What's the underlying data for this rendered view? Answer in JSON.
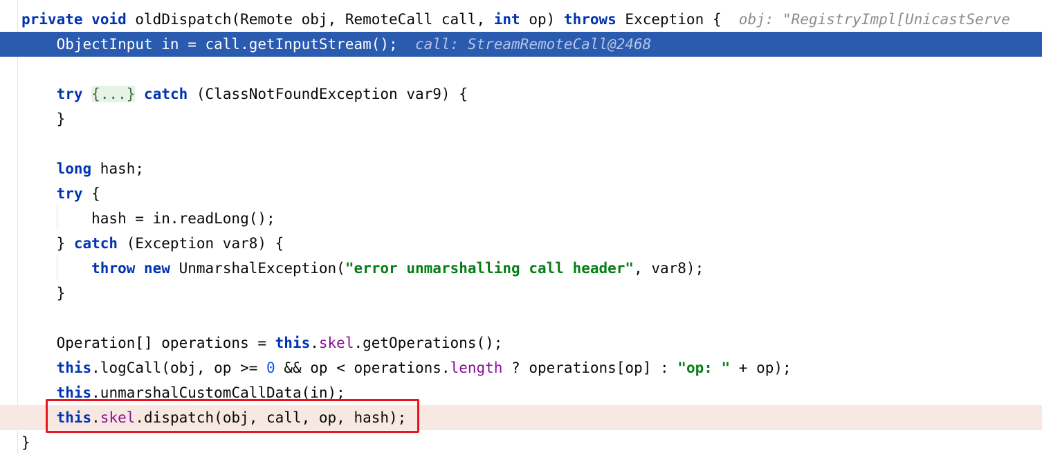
{
  "editor": {
    "language": "java",
    "lines": [
      {
        "id": "l1",
        "tokens": [
          [
            "kw",
            "private"
          ],
          [
            "t",
            " "
          ],
          [
            "kw",
            "void"
          ],
          [
            "t",
            " oldDispatch(Remote obj, RemoteCall call, "
          ],
          [
            "kw",
            "int"
          ],
          [
            "t",
            " op) "
          ],
          [
            "kw",
            "throws"
          ],
          [
            "t",
            " Exception {  "
          ],
          [
            "hint",
            "obj: \"RegistryImpl[UnicastServe"
          ]
        ]
      },
      {
        "id": "l2",
        "selected": true,
        "tokens": [
          [
            "t",
            "    ObjectInput in = call.getInputStream();  "
          ],
          [
            "hint",
            "call: StreamRemoteCall@2468"
          ]
        ]
      },
      {
        "id": "l3",
        "tokens": []
      },
      {
        "id": "l4",
        "tokens": [
          [
            "t",
            "    "
          ],
          [
            "kw",
            "try"
          ],
          [
            "t",
            " "
          ],
          [
            "fold",
            "{...}"
          ],
          [
            "t",
            " "
          ],
          [
            "kw",
            "catch"
          ],
          [
            "t",
            " (ClassNotFoundException var9) {"
          ]
        ]
      },
      {
        "id": "l5",
        "tokens": [
          [
            "t",
            "    }"
          ]
        ]
      },
      {
        "id": "l6",
        "tokens": []
      },
      {
        "id": "l7",
        "tokens": [
          [
            "t",
            "    "
          ],
          [
            "kw",
            "long"
          ],
          [
            "t",
            " hash;"
          ]
        ]
      },
      {
        "id": "l8",
        "tokens": [
          [
            "t",
            "    "
          ],
          [
            "kw",
            "try"
          ],
          [
            "t",
            " {"
          ]
        ]
      },
      {
        "id": "l9",
        "tokens": [
          [
            "t",
            "        hash = in.readLong();"
          ]
        ]
      },
      {
        "id": "l10",
        "tokens": [
          [
            "t",
            "    } "
          ],
          [
            "kw",
            "catch"
          ],
          [
            "t",
            " (Exception var8) {"
          ]
        ]
      },
      {
        "id": "l11",
        "tokens": [
          [
            "t",
            "        "
          ],
          [
            "kw",
            "throw"
          ],
          [
            "t",
            " "
          ],
          [
            "kw",
            "new"
          ],
          [
            "t",
            " UnmarshalException("
          ],
          [
            "str",
            "\"error unmarshalling call header\""
          ],
          [
            "t",
            ", var8);"
          ]
        ]
      },
      {
        "id": "l12",
        "tokens": [
          [
            "t",
            "    }"
          ]
        ]
      },
      {
        "id": "l13",
        "tokens": []
      },
      {
        "id": "l14",
        "tokens": [
          [
            "t",
            "    Operation[] operations = "
          ],
          [
            "kw",
            "this"
          ],
          [
            "t",
            "."
          ],
          [
            "fld",
            "skel"
          ],
          [
            "t",
            ".getOperations();"
          ]
        ]
      },
      {
        "id": "l15",
        "tokens": [
          [
            "t",
            "    "
          ],
          [
            "kw",
            "this"
          ],
          [
            "t",
            ".logCall(obj, op >= "
          ],
          [
            "num",
            "0"
          ],
          [
            "t",
            " && op < operations."
          ],
          [
            "fld",
            "length"
          ],
          [
            "t",
            " ? operations[op] : "
          ],
          [
            "str",
            "\"op: \""
          ],
          [
            "t",
            " + op);"
          ]
        ]
      },
      {
        "id": "l16",
        "tokens": [
          [
            "t",
            "    "
          ],
          [
            "kw",
            "this"
          ],
          [
            "t",
            ".unmarshalCustomCallData(in);"
          ]
        ]
      },
      {
        "id": "l17",
        "breakpoint": true,
        "tokens": [
          [
            "t",
            "    "
          ],
          [
            "kw",
            "this"
          ],
          [
            "t",
            "."
          ],
          [
            "fld",
            "skel"
          ],
          [
            "t",
            ".dispatch(obj, call, op, hash);"
          ]
        ]
      },
      {
        "id": "l18",
        "tokens": [
          [
            "t",
            "}"
          ]
        ]
      }
    ]
  },
  "colors": {
    "selection": "#2a5baf",
    "breakpoint_line": "#f8e8e2",
    "highlight_box": "#e8141e",
    "keyword": "#0033b3",
    "field": "#871094",
    "string": "#067d17",
    "number": "#1750eb",
    "inlay_hint": "#8c8c8c"
  }
}
